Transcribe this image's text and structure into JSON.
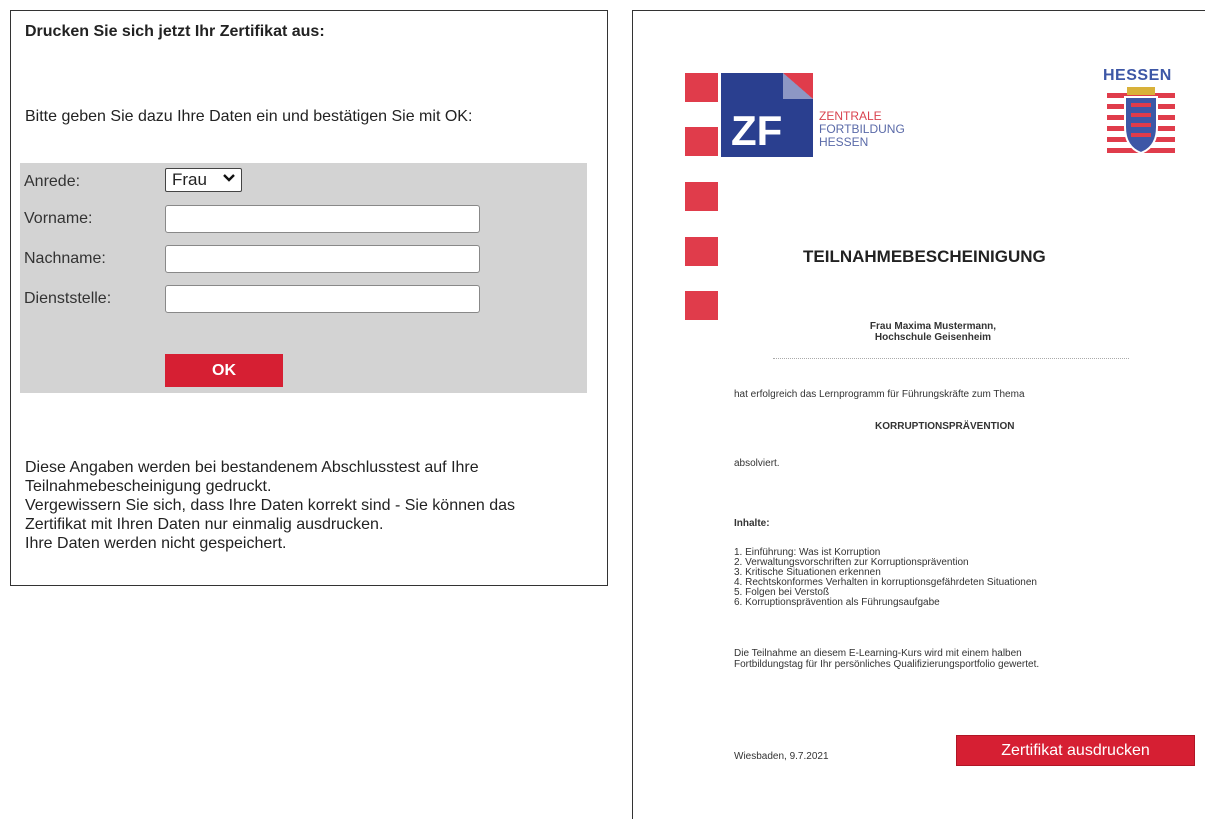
{
  "form_panel": {
    "heading": "Drucken Sie sich jetzt Ihr Zertifikat aus:",
    "intro": "Bitte geben Sie dazu Ihre Daten ein und bestätigen Sie mit OK:",
    "fields": {
      "salutation_label": "Anrede:",
      "salutation_value": "Frau",
      "firstname_label": "Vorname:",
      "firstname_value": "",
      "lastname_label": "Nachname:",
      "lastname_value": "",
      "office_label": "Dienststelle:",
      "office_value": ""
    },
    "ok_label": "OK",
    "note_lines": [
      "Diese Angaben werden bei bestandenem Abschlusstest auf Ihre",
      "Teilnahmebescheinigung gedruckt.",
      "Vergewissern Sie sich, dass Ihre Daten korrekt sind - Sie können das",
      "Zertifikat mit Ihren Daten nur einmalig ausdrucken.",
      "Ihre Daten werden nicht gespeichert."
    ]
  },
  "certificate": {
    "logo_zf": {
      "line1": "ZENTRALE",
      "line2": "FORTBILDUNG",
      "line3": "HESSEN",
      "mark": "ZF"
    },
    "logo_hessen": "HESSEN",
    "title": "TEILNAHMEBESCHEINIGUNG",
    "name_line1": "Frau Maxima Mustermann,",
    "name_line2": "Hochschule Geisenheim",
    "text_success": "hat erfolgreich das Lernprogramm für Führungskräfte zum Thema",
    "topic": "KORRUPTIONSPRÄVENTION",
    "text_completed": "absolviert.",
    "contents_title": "Inhalte:",
    "contents": [
      "1. Einführung: Was ist Korruption",
      "2. Verwaltungsvorschriften zur Korruptionsprävention",
      "3. Kritische Situationen erkennen",
      "4. Rechtskonformes Verhalten in korruptionsgefährdeten Situationen",
      "5. Folgen bei Verstoß",
      "6. Korruptionsprävention als Führungsaufgabe"
    ],
    "footer_line1": "Die Teilnahme an diesem E-Learning-Kurs wird mit einem halben",
    "footer_line2": "Fortbildungstag für Ihr persönliches Qualifizierungsportfolio gewertet.",
    "date": "Wiesbaden, 9.7.2021",
    "print_label": "Zertifikat ausdrucken"
  },
  "colors": {
    "accent_red": "#d61f33",
    "form_bg": "#d3d3d3",
    "logo_blue": "#2a3f8f",
    "logo_red": "#e03c4b"
  }
}
